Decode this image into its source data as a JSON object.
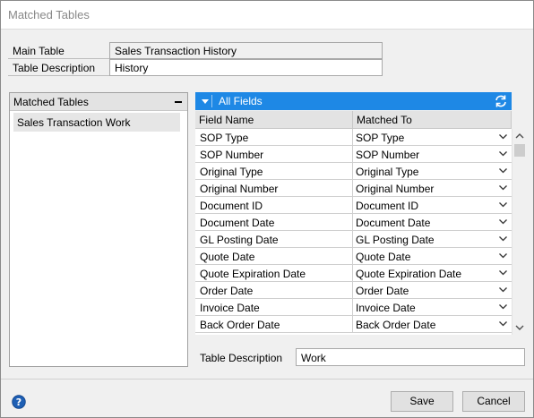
{
  "window": {
    "title": "Matched Tables"
  },
  "header": {
    "main_table_label": "Main Table",
    "main_table_value": "Sales Transaction History",
    "table_description_label": "Table Description",
    "table_description_value": "History"
  },
  "matched_tables": {
    "heading": "Matched Tables",
    "collapse_symbol": "minus-icon",
    "items": [
      "Sales Transaction Work"
    ]
  },
  "fields": {
    "heading": "All Fields",
    "columns": [
      "Field Name",
      "Matched To"
    ],
    "rows": [
      [
        "SOP Type",
        "SOP Type"
      ],
      [
        "SOP Number",
        "SOP Number"
      ],
      [
        "Original Type",
        "Original Type"
      ],
      [
        "Original Number",
        "Original Number"
      ],
      [
        "Document ID",
        "Document ID"
      ],
      [
        "Document Date",
        "Document Date"
      ],
      [
        "GL Posting Date",
        "GL Posting Date"
      ],
      [
        "Quote Date",
        "Quote Date"
      ],
      [
        "Quote Expiration Date",
        "Quote Expiration Date"
      ],
      [
        "Order Date",
        "Order Date"
      ],
      [
        "Invoice Date",
        "Invoice Date"
      ],
      [
        "Back Order Date",
        "Back Order Date"
      ]
    ]
  },
  "bottom": {
    "table_description_label": "Table Description",
    "table_description_value": "Work"
  },
  "buttons": {
    "save": "Save",
    "cancel": "Cancel"
  },
  "colors": {
    "accent": "#1e88e5",
    "help_icon": "#1e5fb4"
  }
}
